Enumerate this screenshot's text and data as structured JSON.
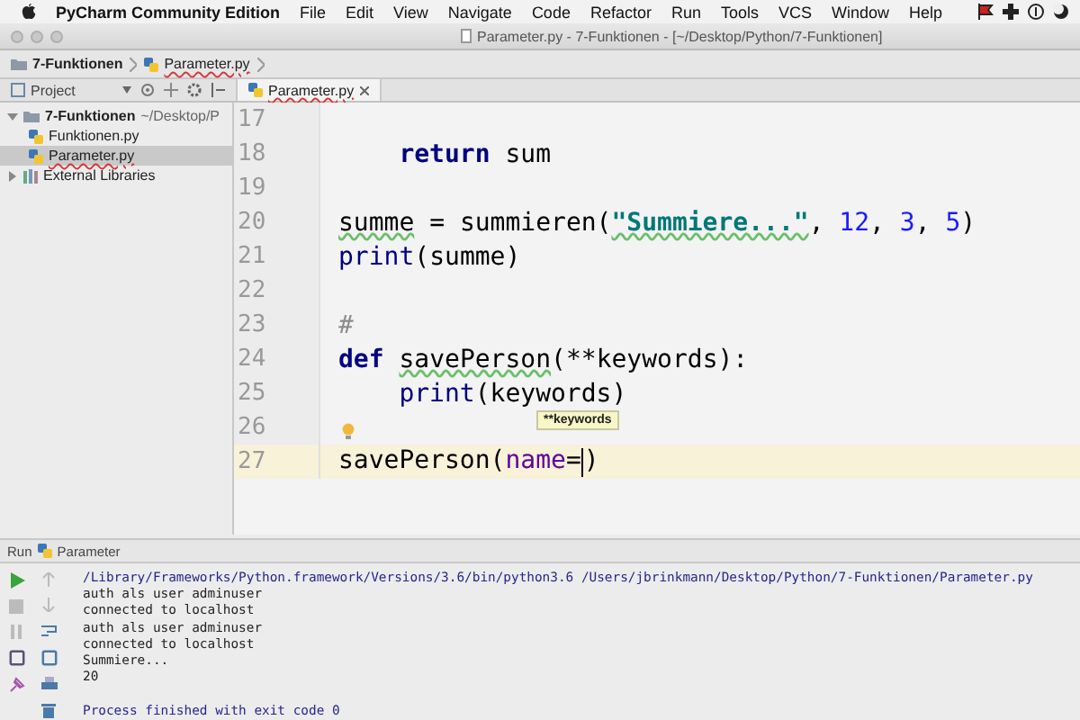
{
  "menu_bar": {
    "app": "PyCharm Community Edition",
    "items": [
      "File",
      "Edit",
      "View",
      "Navigate",
      "Code",
      "Refactor",
      "Run",
      "Tools",
      "VCS",
      "Window",
      "Help"
    ]
  },
  "window": {
    "title": "Parameter.py - 7-Funktionen - [~/Desktop/Python/7-Funktionen]"
  },
  "breadcrumb": [
    {
      "label": "7-Funktionen",
      "kind": "folder"
    },
    {
      "label": "Parameter.py",
      "kind": "file"
    }
  ],
  "project_panel": {
    "title": "Project"
  },
  "tabs": [
    {
      "label": "Parameter.py",
      "selected": true
    }
  ],
  "tree": [
    {
      "label": "7-Funktionen",
      "path": "~/Desktop/P",
      "kind": "folder",
      "expanded": true,
      "selected": false,
      "children": [
        {
          "label": "Funktionen.py",
          "kind": "file",
          "selected": false
        },
        {
          "label": "Parameter.py",
          "kind": "file",
          "selected": true
        }
      ]
    },
    {
      "label": "External Libraries",
      "kind": "library",
      "expanded": false,
      "selected": false
    }
  ],
  "editor": {
    "lines": [
      {
        "number": "17",
        "current": false
      },
      {
        "number": "18",
        "current": false,
        "indented": true,
        "tokens": [
          {
            "text": "return",
            "kind": "keyword"
          },
          {
            "text": " sum",
            "kind": "plain"
          }
        ]
      },
      {
        "number": "19",
        "current": false
      },
      {
        "number": "20",
        "current": false,
        "tokens": [
          {
            "text": "summe",
            "kind": "plain",
            "underlined": true
          },
          {
            "text": " = summieren(",
            "kind": "plain"
          },
          {
            "text": "\"Summiere...\"",
            "kind": "string",
            "underlined": true
          },
          {
            "text": ", ",
            "kind": "plain"
          },
          {
            "text": "12",
            "kind": "number"
          },
          {
            "text": ", ",
            "kind": "plain"
          },
          {
            "text": "3",
            "kind": "number"
          },
          {
            "text": ", ",
            "kind": "plain"
          },
          {
            "text": "5",
            "kind": "number"
          },
          {
            "text": ")",
            "kind": "plain"
          }
        ]
      },
      {
        "number": "21",
        "current": false,
        "tokens": [
          {
            "text": "print",
            "kind": "builtin"
          },
          {
            "text": "(summe)",
            "kind": "plain"
          }
        ]
      },
      {
        "number": "22",
        "current": false
      },
      {
        "number": "23",
        "current": false,
        "tokens": [
          {
            "text": "#",
            "kind": "comment"
          }
        ]
      },
      {
        "number": "24",
        "current": false,
        "tokens": [
          {
            "text": "def",
            "kind": "keyword"
          },
          {
            "text": "savePerson",
            "kind": "plain",
            "underlined": true,
            "spaced": true
          },
          {
            "text": "(**keywords):",
            "kind": "plain"
          }
        ]
      },
      {
        "number": "25",
        "current": false,
        "indented": true,
        "tokens": [
          {
            "text": "print",
            "kind": "builtin"
          },
          {
            "text": "(keywords)",
            "kind": "plain"
          }
        ]
      },
      {
        "number": "26",
        "current": false
      },
      {
        "number": "27",
        "current": true,
        "tokens": [
          {
            "text": "savePerson(",
            "kind": "plain"
          },
          {
            "text": "name",
            "kind": "param"
          },
          {
            "text": "=",
            "kind": "plain"
          },
          {
            "text": ")",
            "kind": "plain"
          }
        ]
      }
    ],
    "tooltip": "**keywords"
  },
  "run_panel": {
    "label": "Run",
    "config": "Parameter",
    "output": [
      {
        "text": "/Library/Frameworks/Python.framework/Versions/3.6/bin/python3.6 /Users/jbrinkmann/Desktop/Python/7-Funktionen/Parameter.py",
        "kind": "command"
      },
      {
        "text": "auth als user adminuser",
        "kind": "stdout"
      },
      {
        "text": "connected to localhost",
        "kind": "stdout"
      },
      {
        "text": "auth als user adminuser",
        "kind": "stdout"
      },
      {
        "text": "connected to localhost",
        "kind": "stdout"
      },
      {
        "text": "Summiere...",
        "kind": "stdout"
      },
      {
        "text": "20",
        "kind": "stdout"
      },
      {
        "kind": "blank"
      },
      {
        "text": "Process finished with exit code 0",
        "kind": "command"
      }
    ]
  }
}
